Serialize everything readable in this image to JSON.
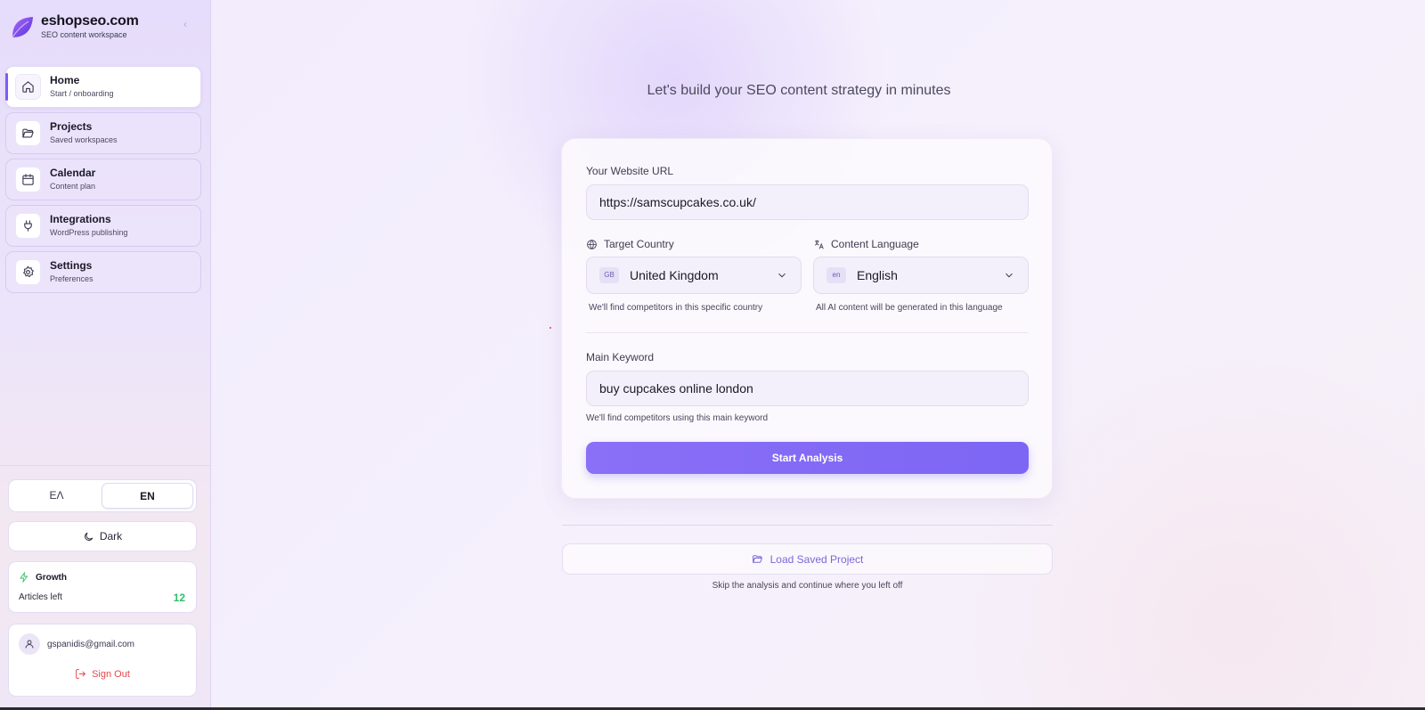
{
  "brand": {
    "name": "eshopseo.com",
    "subtitle": "SEO content workspace"
  },
  "sidebar": {
    "items": [
      {
        "label": "Home",
        "sub": "Start / onboarding",
        "icon": "home-icon",
        "active": true
      },
      {
        "label": "Projects",
        "sub": "Saved workspaces",
        "icon": "folder-open-icon"
      },
      {
        "label": "Calendar",
        "sub": "Content plan",
        "icon": "calendar-icon"
      },
      {
        "label": "Integrations",
        "sub": "WordPress publishing",
        "icon": "plug-icon"
      },
      {
        "label": "Settings",
        "sub": "Preferences",
        "icon": "gear-icon"
      }
    ],
    "lang_options": [
      "ΕΛ",
      "EN"
    ],
    "lang_selected": "EN",
    "theme_label": "Dark",
    "plan": {
      "name": "Growth",
      "articles_label": "Articles left",
      "articles_value": "12"
    },
    "user": {
      "email": "gspanidis@gmail.com",
      "signout_label": "Sign Out"
    }
  },
  "main": {
    "headline": "Let's build your SEO content strategy in minutes",
    "form": {
      "url_label": "Your Website URL",
      "url_value": "https://samscupcakes.co.uk/",
      "country_label": "Target Country",
      "country_code": "GB",
      "country_value": "United Kingdom",
      "country_hint": "We'll find competitors in this specific country",
      "language_label": "Content Language",
      "language_code": "en",
      "language_value": "English",
      "language_hint": "All AI content will be generated in this language",
      "keyword_label": "Main Keyword",
      "keyword_value": "buy cupcakes online london",
      "keyword_hint": "We'll find competitors using this main keyword",
      "start_label": "Start Analysis"
    },
    "load_label": "Load Saved Project",
    "load_hint": "Skip the analysis and continue where you left off"
  },
  "colors": {
    "accent": "#7d66f4",
    "success": "#2fbf6a",
    "danger": "#e5484d"
  }
}
